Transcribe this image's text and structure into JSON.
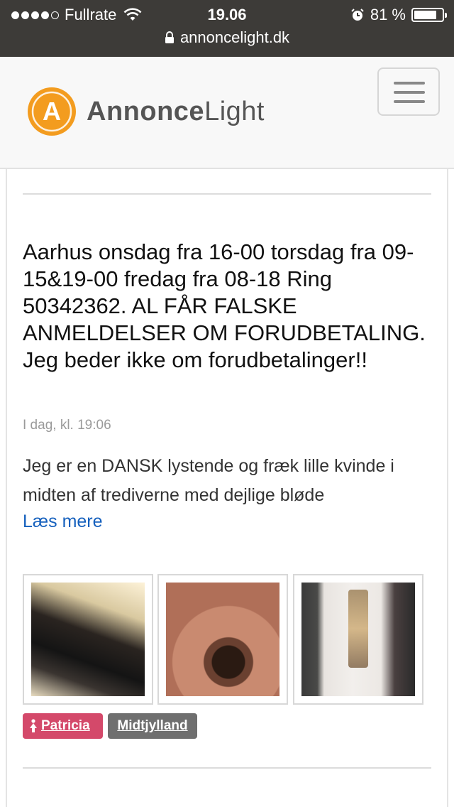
{
  "status_bar": {
    "carrier": "Fullrate",
    "time": "19.06",
    "battery": "81 %",
    "battery_level": 0.81,
    "url": "annoncelight.dk",
    "icons": [
      "signal-dots",
      "wifi-icon",
      "alarm-icon",
      "battery-icon",
      "lock-icon"
    ]
  },
  "header": {
    "logo_letter": "A",
    "logo_bold": "Annonce",
    "logo_light": "Light",
    "menu_icon": "hamburger-menu-icon",
    "logo_color": "#f39c1f"
  },
  "ad": {
    "title": "Aarhus onsdag fra 16-00 torsdag fra 09-15&19-00 fredag fra 08-18 Ring 50342362. AL FÅR FALSKE ANMELDELSER OM FORUDBETALING. Jeg beder ikke om forudbetalinger!!",
    "date": "I dag, kl. 19:06",
    "excerpt": "Jeg er en DANSK lystende og fræk lille kvinde i midten af trediverne med dejlige bløde",
    "read_more": "Læs mere",
    "tags": {
      "name": "Patricia",
      "name_icon": "female-icon",
      "region": "Midtjylland"
    },
    "colors": {
      "link": "#1560bd",
      "tag_name_bg": "#d4496a",
      "tag_region_bg": "#6f6f6f"
    }
  }
}
